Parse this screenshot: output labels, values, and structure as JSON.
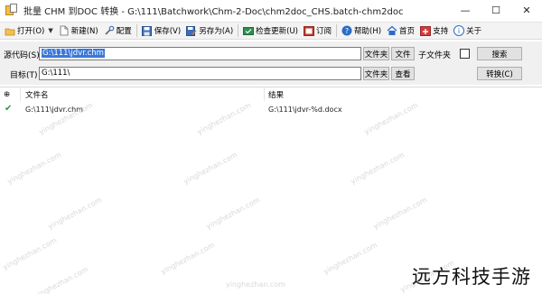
{
  "window": {
    "title": "批量 CHM 到DOC 转换 - G:\\111\\Batchwork\\Chm-2-Doc\\chm2doc_CHS.batch-chm2doc",
    "minimize": "—",
    "maximize": "☐",
    "close": "✕"
  },
  "toolbar": {
    "items": [
      {
        "label": "打开(O)",
        "icon": "folder-open-icon"
      },
      {
        "label": "新建(N)",
        "icon": "new-file-icon"
      },
      {
        "label": "配置",
        "icon": "tools-icon"
      },
      {
        "label": "保存(V)",
        "icon": "save-icon"
      },
      {
        "label": "另存为(A)",
        "icon": "save-as-icon"
      },
      {
        "label": "检查更新(U)",
        "icon": "update-icon"
      },
      {
        "label": "订阅",
        "icon": "subscribe-icon"
      },
      {
        "label": "帮助(H)",
        "icon": "help-icon"
      },
      {
        "label": "首页",
        "icon": "home-icon"
      },
      {
        "label": "支持",
        "icon": "support-icon"
      },
      {
        "label": "关于",
        "icon": "info-icon"
      }
    ]
  },
  "form": {
    "source_label": "源代码(S)",
    "source_value": "G:\\111\\jdvr.chm",
    "folder_btn": "文件夹",
    "file_btn": "文件",
    "subfolder_label": "子文件夹",
    "search_btn": "搜索",
    "target_label": "目标(T)",
    "target_value": "G:\\111\\",
    "target_folder_btn": "文件夹",
    "view_btn": "查看",
    "convert_btn": "转换(C)"
  },
  "list": {
    "headers": {
      "status": "⊕",
      "filename": "文件名",
      "result": "结果"
    },
    "rows": [
      {
        "status": "✔",
        "filename": "G:\\111\\jdvr.chm",
        "result": "G:\\111\\jdvr-%d.docx"
      }
    ]
  },
  "watermarks": [
    "yinghezhan.com",
    "yinghezhan.com",
    "yinghezhan.com",
    "yinghezhan.com",
    "yinghezhan.com",
    "yinghezhan.com",
    "yinghezhan.com",
    "yinghezhan.com",
    "yinghezhan.com",
    "yinghezhan.com",
    "yinghezhan.com",
    "yinghezhan.com",
    "yinghezhan.com",
    "yinghezhan.com",
    "yinghezhan.com"
  ],
  "brand_overlay": "远方科技手游"
}
